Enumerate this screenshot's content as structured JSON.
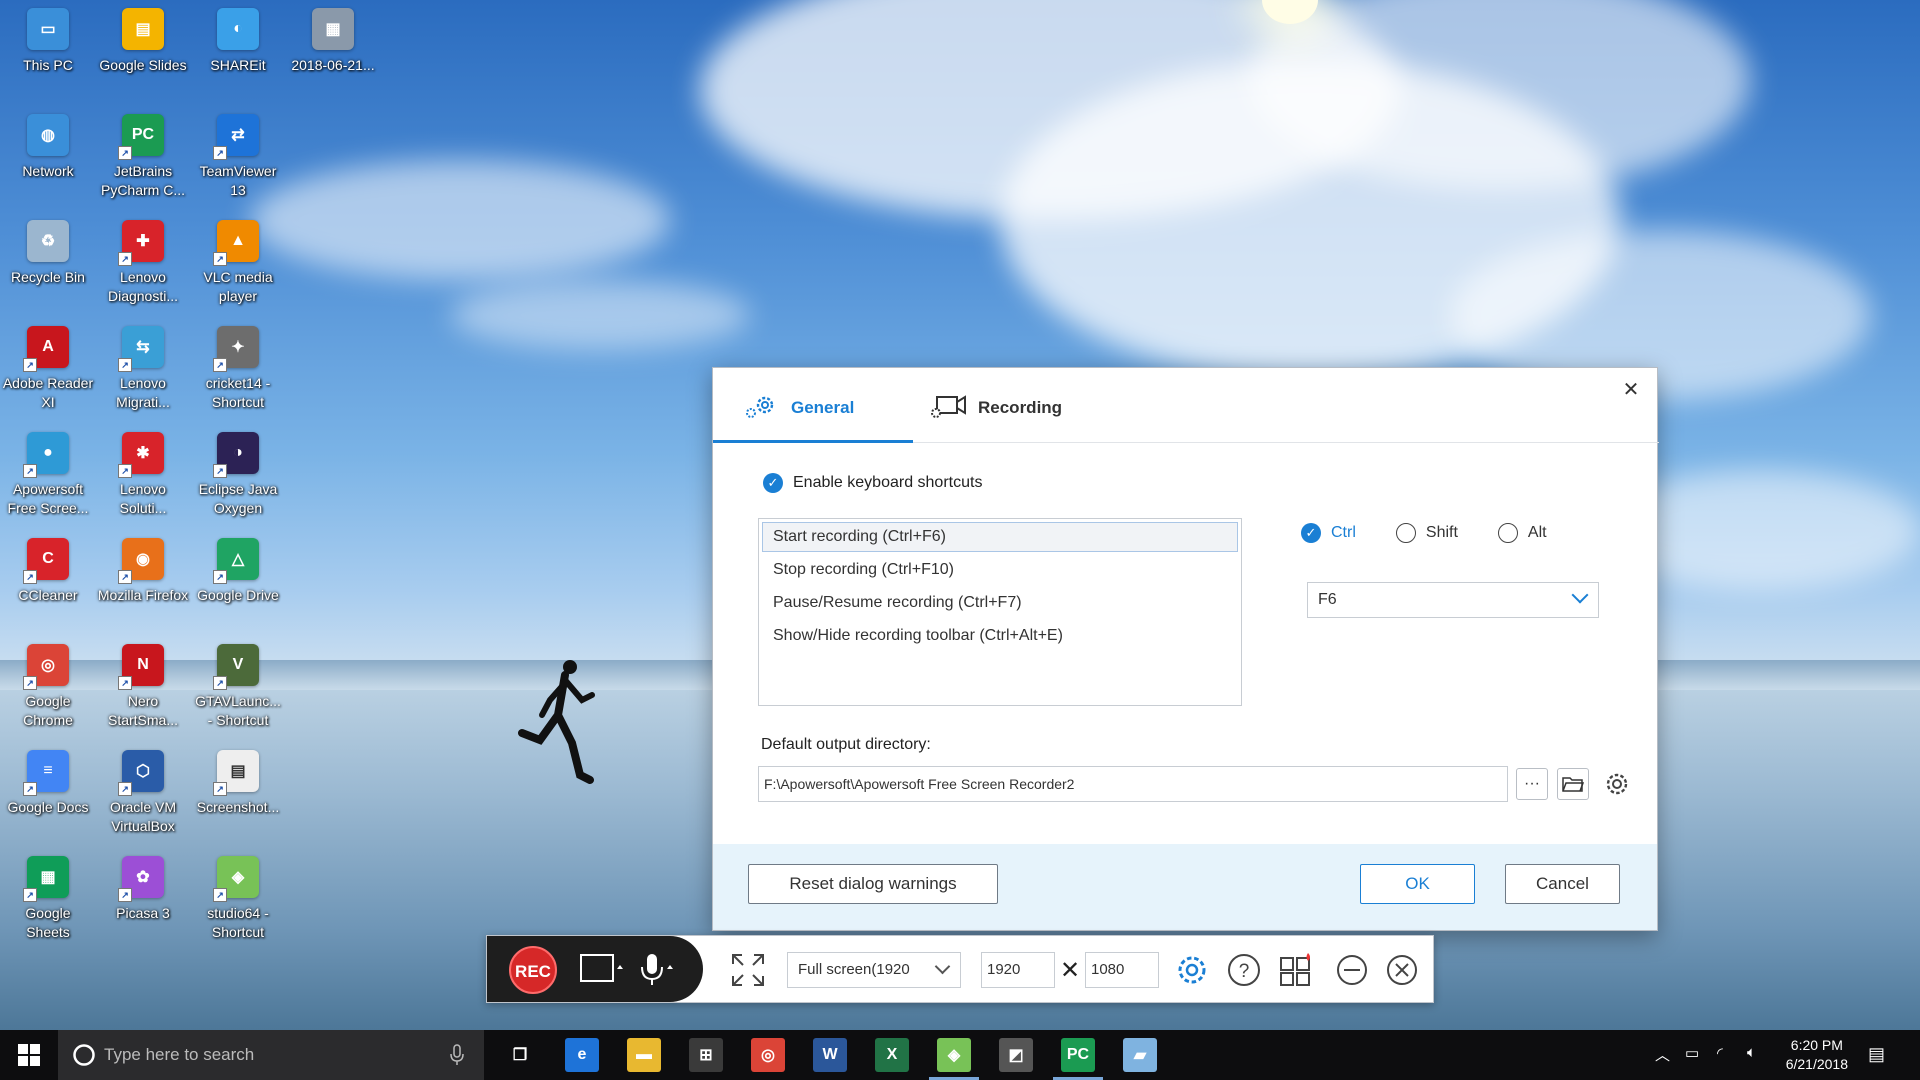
{
  "desktop": {
    "icons": [
      {
        "label": "This PC",
        "color": "#3a8fd9",
        "glyph": "▭"
      },
      {
        "label": "Google Slides",
        "color": "#f4b400",
        "glyph": "▤"
      },
      {
        "label": "SHAREit",
        "color": "#3aa0e8",
        "glyph": "◐"
      },
      {
        "label": "2018-06-21...",
        "color": "#8a99aa",
        "glyph": "▦"
      },
      {
        "label": "Network",
        "color": "#3a8fd9",
        "glyph": "◍"
      },
      {
        "label": "JetBrains PyCharm C...",
        "color": "#1b9b52",
        "glyph": "PC"
      },
      {
        "label": "TeamViewer 13",
        "color": "#1e73d8",
        "glyph": "⇄"
      },
      {
        "label": "Recycle Bin",
        "color": "#9bb6cf",
        "glyph": "♻"
      },
      {
        "label": "Lenovo Diagnosti...",
        "color": "#d8232a",
        "glyph": "✚"
      },
      {
        "label": "VLC media player",
        "color": "#f08a00",
        "glyph": "▲"
      },
      {
        "label": "Adobe Reader XI",
        "color": "#c8161d",
        "glyph": "A"
      },
      {
        "label": "Lenovo Migrati...",
        "color": "#3a9fd6",
        "glyph": "⇆"
      },
      {
        "label": "cricket14 - Shortcut",
        "color": "#6d6d6d",
        "glyph": "✦"
      },
      {
        "label": "Apowersoft Free Scree...",
        "color": "#2e9ad6",
        "glyph": "●"
      },
      {
        "label": "Lenovo Soluti...",
        "color": "#d8232a",
        "glyph": "✱"
      },
      {
        "label": "Eclipse Java Oxygen",
        "color": "#2c2255",
        "glyph": "◑"
      },
      {
        "label": "CCleaner",
        "color": "#d8232a",
        "glyph": "C"
      },
      {
        "label": "Mozilla Firefox",
        "color": "#e8701a",
        "glyph": "◉"
      },
      {
        "label": "Google Drive",
        "color": "#1fa463",
        "glyph": "△"
      },
      {
        "label": "Google Chrome",
        "color": "#db4437",
        "glyph": "◎"
      },
      {
        "label": "Nero StartSma...",
        "color": "#c8161d",
        "glyph": "N"
      },
      {
        "label": "GTAVLaunc... - Shortcut",
        "color": "#4c6a3a",
        "glyph": "V"
      },
      {
        "label": "Google Docs",
        "color": "#4285f4",
        "glyph": "≡"
      },
      {
        "label": "Oracle VM VirtualBox",
        "color": "#2a5ca8",
        "glyph": "⬡"
      },
      {
        "label": "Screenshot...",
        "color": "#eeeeee",
        "glyph": "▤"
      },
      {
        "label": "Google Sheets",
        "color": "#0f9d58",
        "glyph": "▦"
      },
      {
        "label": "Picasa 3",
        "color": "#9c4fd6",
        "glyph": "✿"
      },
      {
        "label": "studio64 - Shortcut",
        "color": "#78c257",
        "glyph": "◈"
      }
    ]
  },
  "dialog": {
    "close_label": "✕",
    "tabs": {
      "general": "General",
      "recording": "Recording"
    },
    "enable_shortcuts": "Enable keyboard shortcuts",
    "shortcuts": [
      "Start recording (Ctrl+F6)",
      "Stop recording (Ctrl+F10)",
      "Pause/Resume recording (Ctrl+F7)",
      "Show/Hide recording toolbar (Ctrl+Alt+E)"
    ],
    "modifiers": {
      "ctrl": "Ctrl",
      "shift": "Shift",
      "alt": "Alt"
    },
    "key_selected": "F6",
    "output_label": "Default output directory:",
    "output_path": "F:\\Apowersoft\\Apowersoft Free Screen Recorder2",
    "browse_label": "···",
    "buttons": {
      "reset": "Reset dialog warnings",
      "ok": "OK",
      "cancel": "Cancel"
    }
  },
  "toolbar": {
    "rec_label": "REC",
    "mode_selected": "Full screen(1920",
    "width": "1920",
    "height": "1080",
    "times_glyph": "✕"
  },
  "taskbar": {
    "search_placeholder": "Type here to search",
    "time": "6:20 PM",
    "date": "6/21/2018",
    "apps": [
      {
        "name": "task-view",
        "glyph": "❐",
        "color": "transparent"
      },
      {
        "name": "edge",
        "glyph": "e",
        "color": "#1e73d8"
      },
      {
        "name": "file-explorer",
        "glyph": "▬",
        "color": "#e8b830"
      },
      {
        "name": "store",
        "glyph": "⊞",
        "color": "#3a3a3a"
      },
      {
        "name": "chrome",
        "glyph": "◎",
        "color": "#db4437"
      },
      {
        "name": "word",
        "glyph": "W",
        "color": "#2b579a"
      },
      {
        "name": "excel",
        "glyph": "X",
        "color": "#217346"
      },
      {
        "name": "android-studio",
        "glyph": "◈",
        "color": "#78c257"
      },
      {
        "name": "gpu-app",
        "glyph": "◩",
        "color": "#555555"
      },
      {
        "name": "pycharm",
        "glyph": "PC",
        "color": "#1b9b52"
      },
      {
        "name": "notes-app",
        "glyph": "▰",
        "color": "#7fb3e0"
      }
    ]
  }
}
